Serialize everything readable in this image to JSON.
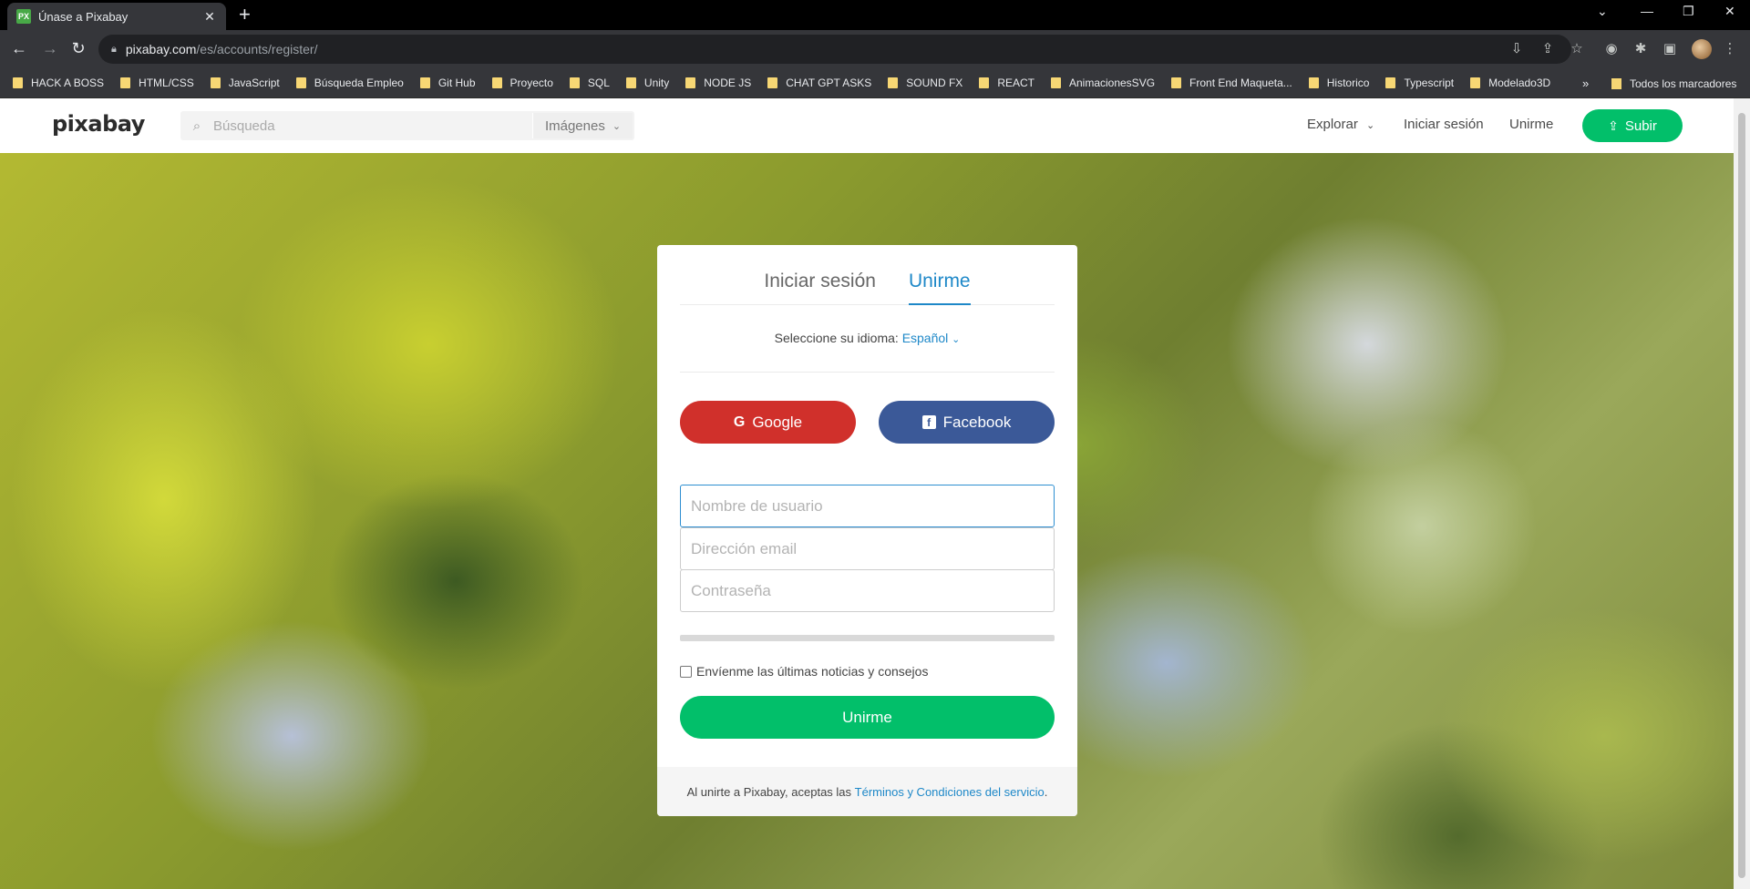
{
  "browser": {
    "tab_title": "Únase a Pixabay",
    "tab_favicon": "PX",
    "url_host": "pixabay.com",
    "url_path": "/es/accounts/register/",
    "bookmarks": [
      "HACK A BOSS",
      "HTML/CSS",
      "JavaScript",
      "Búsqueda Empleo",
      "Git Hub",
      "Proyecto",
      "SQL",
      "Unity",
      "NODE JS",
      "CHAT GPT ASKS",
      "SOUND FX",
      "REACT",
      "AnimacionesSVG",
      "Front End Maqueta...",
      "Historico",
      "Typescript",
      "Modelado3D"
    ],
    "bookmarks_more": "»",
    "all_bookmarks": "Todos los marcadores"
  },
  "header": {
    "logo": "pixabay",
    "search_placeholder": "Búsqueda",
    "search_type": "Imágenes",
    "nav_explore": "Explorar",
    "nav_login": "Iniciar sesión",
    "nav_join": "Unirme",
    "upload": "Subir"
  },
  "card": {
    "tab_login": "Iniciar sesión",
    "tab_join": "Unirme",
    "language_label": "Seleccione su idioma:",
    "language_value": "Español",
    "google": "Google",
    "facebook": "Facebook",
    "username_placeholder": "Nombre de usuario",
    "email_placeholder": "Dirección email",
    "password_placeholder": "Contraseña",
    "newsletter": "Envíenme las últimas noticias y consejos",
    "submit": "Unirme",
    "terms_prefix": "Al unirte a Pixabay, aceptas las ",
    "terms_link": "Términos y Condiciones del servicio",
    "terms_suffix": "."
  },
  "colors": {
    "accent_green": "#02bf6a",
    "link_blue": "#1e88c8",
    "google_red": "#d0302b",
    "facebook_blue": "#3b5998"
  }
}
